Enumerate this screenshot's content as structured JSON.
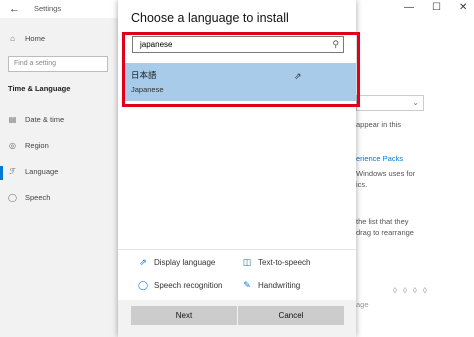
{
  "window": {
    "title": "Settings",
    "back_icon": "←",
    "controls": {
      "minimize": "—",
      "maximize": "☐",
      "close": "✕"
    }
  },
  "sidebar": {
    "home": "Home",
    "search_placeholder": "Find a setting",
    "section_title": "Time & Language",
    "items": [
      {
        "label": "Date & time",
        "icon": "calendar-clock-icon"
      },
      {
        "label": "Region",
        "icon": "globe-icon"
      },
      {
        "label": "Language",
        "icon": "language-icon"
      },
      {
        "label": "Speech",
        "icon": "microphone-icon"
      }
    ]
  },
  "background_content": {
    "appear_text": "appear in this",
    "link_text": "erience Packs",
    "windows_text1": "Windows uses for",
    "windows_text2": "ics.",
    "list_text1": "the list that they",
    "list_text2": "drag to rearrange",
    "partial": "age"
  },
  "dialog": {
    "title": "Choose a language to install",
    "search": {
      "value": "japanese"
    },
    "results": [
      {
        "native": "日本語",
        "english": "Japanese",
        "selected": true
      }
    ],
    "features": [
      {
        "label": "Display language",
        "icon": "display-language-icon"
      },
      {
        "label": "Text-to-speech",
        "icon": "text-to-speech-icon"
      },
      {
        "label": "Speech recognition",
        "icon": "microphone-icon"
      },
      {
        "label": "Handwriting",
        "icon": "handwriting-icon"
      }
    ],
    "buttons": {
      "next": "Next",
      "cancel": "Cancel"
    }
  },
  "colors": {
    "selection": "#a7cbe9",
    "highlight_box": "#e0001b",
    "accent": "#0078d7",
    "button": "#cccccc"
  }
}
